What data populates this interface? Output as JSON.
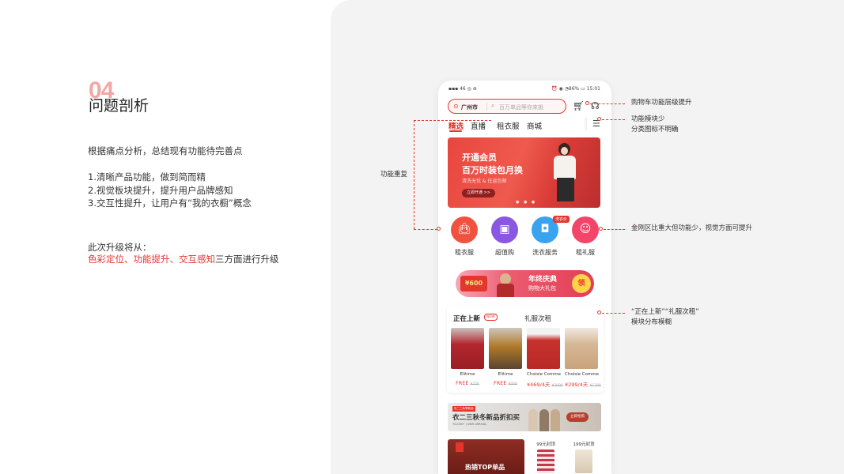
{
  "section": {
    "number": "04",
    "title": "问题剖析"
  },
  "intro": "根据痛点分析，总结现有功能待完善点",
  "points": [
    "1.清晰产品功能，做到简而精",
    "2.视觉板块提升，提升用户品牌感知",
    "3.交互性提升，让用户有“我的衣橱”概念"
  ],
  "plan": {
    "intro": "此次升级将从：",
    "highlight": "色彩定位、功能提升、交互感知",
    "rest": "三方面进行升级"
  },
  "phone": {
    "status": {
      "left": "▪︎▪︎▪︎ 46 ◎ ⊛",
      "right": "⏰ ◉ ◔86% ▭ 15:01"
    },
    "search": {
      "pin_icon": "location-pin-icon",
      "city": "广州市",
      "placeholder": "百万单品等你来挑"
    },
    "tabs": [
      "精选",
      "直播",
      "租衣服",
      "商城"
    ],
    "banner": {
      "line1": "开通会员",
      "line2": "百万时装包月换",
      "line3": "清洗无忧 & 往返包邮",
      "button": "立即开通 >>"
    },
    "categories": [
      {
        "label": "租衣服",
        "icon": "bag-icon",
        "color": "#f0523f"
      },
      {
        "label": "超值购",
        "icon": "shopping-bag-icon",
        "color": "#8a57e0"
      },
      {
        "label": "洗衣服务",
        "icon": "washing-machine-icon",
        "color": "#3aa3f0"
      },
      {
        "label": "租礼服",
        "icon": "dress-icon",
        "color": "#f2456a"
      }
    ],
    "category_tag": "洗衣价",
    "promo": {
      "coupon": "¥600",
      "line1": "年终庆典",
      "line2": "购物大礼包",
      "claim": "领"
    },
    "new_section": {
      "title": "正在上新",
      "badge": "NEW",
      "tab2": "礼服次租",
      "products": [
        {
          "brand": "Elitime",
          "price": "FREE",
          "orig": "¥356",
          "color": "#b3262d"
        },
        {
          "brand": "Elitime",
          "price": "FREE",
          "orig": "¥468",
          "color": "#b07a2a"
        },
        {
          "brand": "Choisie Comme",
          "price": "¥469/4天",
          "orig": "¥2699",
          "color": "#c8322d"
        },
        {
          "brand": "Choisie Comme",
          "price": "¥299/4天",
          "orig": "¥1299",
          "color": "#d6b796"
        }
      ]
    },
    "ad": {
      "tag": "衣二三秋季新品",
      "line1": "衣二三秋冬新品折扣买",
      "line2": "YCLOSET | NEW ARRIVAL",
      "button": "立即抢购"
    },
    "bottom": {
      "top_title": "热销TOP单品",
      "item1": "99元封顶",
      "item2": "199元封顶"
    }
  },
  "annotations": {
    "cart": "购物车功能层级提升",
    "menu_line1": "功能模块少",
    "menu_line2": "分类图标不明确",
    "duplicate": "功能重复",
    "icons": "金刚区比重大但功能少，视觉方面可提升",
    "new_line1": "“正在上新”“礼服次租”",
    "new_line2": "模块分布模糊"
  },
  "colors": {
    "accent": "#e5362e",
    "panel": "#f3f3f3"
  }
}
